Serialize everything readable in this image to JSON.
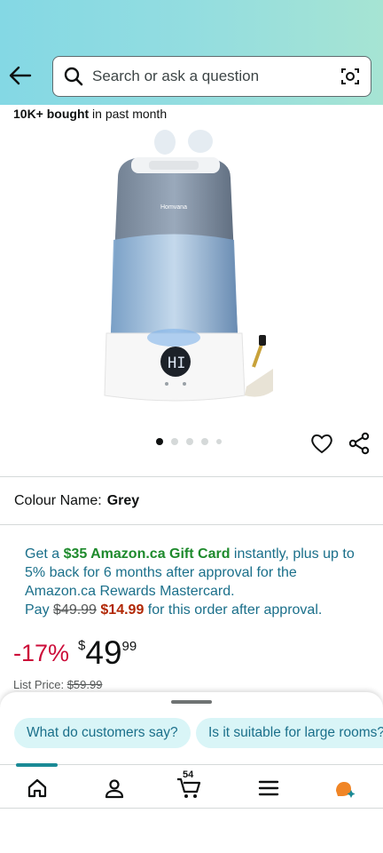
{
  "search": {
    "placeholder": "Search or ask a question"
  },
  "social_proof": {
    "count": "10K+ bought",
    "suffix": " in past month"
  },
  "product": {
    "brand_on_image": "Homvana",
    "display_on_image": "HI",
    "carousel": {
      "total_images": 5,
      "active_index": 0
    }
  },
  "colour": {
    "label": "Colour Name:",
    "value": "Grey"
  },
  "promo": {
    "get_a": "Get a ",
    "gift_card": "$35 Amazon.ca Gift Card",
    "line_rest": " instantly, plus up to 5% back for 6 months after approval for the Amazon.ca Rewards Mastercard.",
    "pay": "Pay ",
    "old_price": "$49.99",
    "new_price": "$14.99",
    "after": " for this order after approval."
  },
  "price": {
    "discount": "-17%",
    "currency": "$",
    "whole": "49",
    "fraction": "99"
  },
  "list_price": {
    "label": "List Price: ",
    "value": "$59.99"
  },
  "suggestions": [
    {
      "label": "What do customers say?"
    },
    {
      "label": "Is it suitable for large rooms?"
    }
  ],
  "nav": {
    "cart_count": "54"
  },
  "colors": {
    "accent": "#1a8a96",
    "deal_red": "#cc0c39",
    "link_blue": "#1a6f8a",
    "gift_green": "#1e8a2c"
  }
}
